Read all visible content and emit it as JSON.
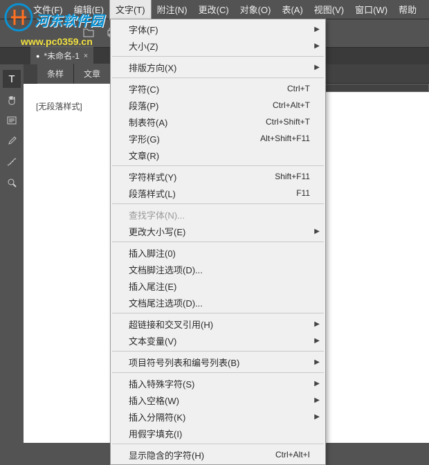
{
  "watermark": {
    "text": "河东软件园",
    "url": "www.pc0359.cn"
  },
  "menubar": {
    "items": [
      {
        "label": "文件(F)"
      },
      {
        "label": "编辑(E)"
      },
      {
        "label": "文字(T)",
        "active": true
      },
      {
        "label": "附注(N)"
      },
      {
        "label": "更改(C)"
      },
      {
        "label": "对象(O)"
      },
      {
        "label": "表(A)"
      },
      {
        "label": "视图(V)"
      },
      {
        "label": "窗口(W)"
      },
      {
        "label": "帮助"
      }
    ]
  },
  "doc_tab": {
    "label": "*未命名-1",
    "close": "×"
  },
  "sub_tabs": [
    {
      "label": "条样"
    },
    {
      "label": "文章"
    }
  ],
  "content": {
    "no_style": "[无段落样式]"
  },
  "menu": {
    "groups": [
      [
        {
          "label": "字体(F)",
          "submenu": true
        },
        {
          "label": "大小(Z)",
          "submenu": true
        }
      ],
      [
        {
          "label": "排版方向(X)",
          "submenu": true
        }
      ],
      [
        {
          "label": "字符(C)",
          "shortcut": "Ctrl+T"
        },
        {
          "label": "段落(P)",
          "shortcut": "Ctrl+Alt+T"
        },
        {
          "label": "制表符(A)",
          "shortcut": "Ctrl+Shift+T"
        },
        {
          "label": "字形(G)",
          "shortcut": "Alt+Shift+F11"
        },
        {
          "label": "文章(R)"
        }
      ],
      [
        {
          "label": "字符样式(Y)",
          "shortcut": "Shift+F11"
        },
        {
          "label": "段落样式(L)",
          "shortcut": "F11"
        }
      ],
      [
        {
          "label": "查找字体(N)...",
          "disabled": true
        },
        {
          "label": "更改大小写(E)",
          "submenu": true
        }
      ],
      [
        {
          "label": "插入脚注(0)"
        },
        {
          "label": "文档脚注选项(D)..."
        },
        {
          "label": "插入尾注(E)"
        },
        {
          "label": "文档尾注选项(D)..."
        }
      ],
      [
        {
          "label": "超链接和交叉引用(H)",
          "submenu": true
        },
        {
          "label": "文本变量(V)",
          "submenu": true
        }
      ],
      [
        {
          "label": "项目符号列表和编号列表(B)",
          "submenu": true
        }
      ],
      [
        {
          "label": "插入特殊字符(S)",
          "submenu": true
        },
        {
          "label": "插入空格(W)",
          "submenu": true
        },
        {
          "label": "插入分隔符(K)",
          "submenu": true
        },
        {
          "label": "用假字填充(I)"
        }
      ],
      [
        {
          "label": "显示隐含的字符(H)",
          "shortcut": "Ctrl+Alt+I"
        }
      ]
    ]
  }
}
